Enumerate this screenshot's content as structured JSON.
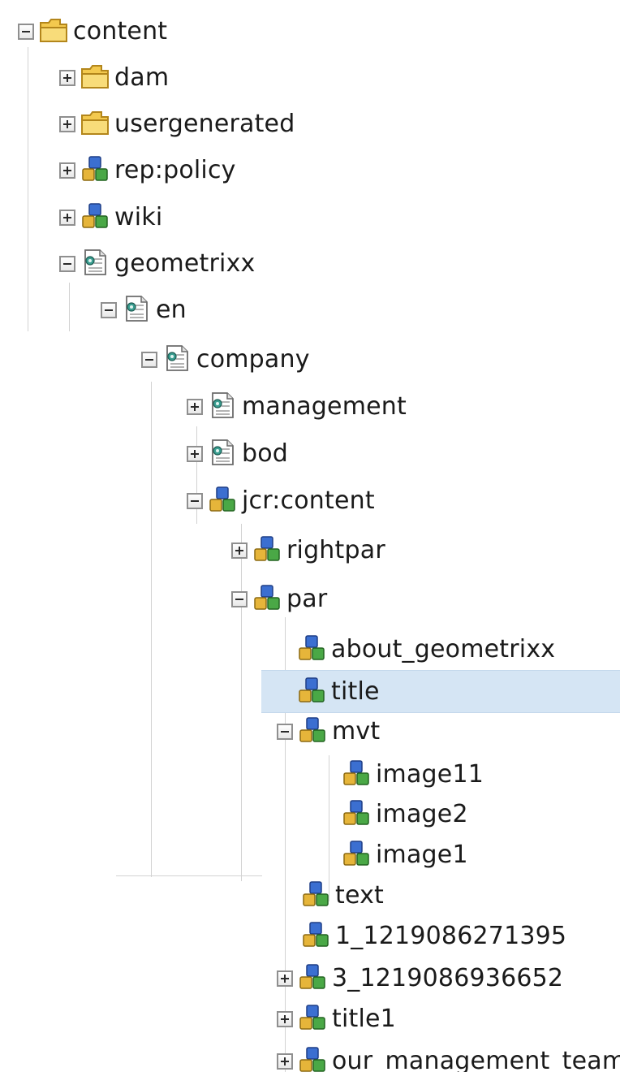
{
  "tree": {
    "nodes": [
      {
        "key": "content",
        "label": "content",
        "icon": "folder-icon",
        "toggle": "minus"
      },
      {
        "key": "dam",
        "label": "dam",
        "icon": "folder-icon",
        "toggle": "plus"
      },
      {
        "key": "usergenerated",
        "label": "usergenerated",
        "icon": "folder-icon",
        "toggle": "plus"
      },
      {
        "key": "rep-policy",
        "label": "rep:policy",
        "icon": "node-cubes-icon",
        "toggle": "plus"
      },
      {
        "key": "wiki",
        "label": "wiki",
        "icon": "node-cubes-icon",
        "toggle": "plus"
      },
      {
        "key": "geometrixx",
        "label": "geometrixx",
        "icon": "page-icon",
        "toggle": "minus"
      },
      {
        "key": "en",
        "label": "en",
        "icon": "page-icon",
        "toggle": "minus"
      },
      {
        "key": "company",
        "label": "company",
        "icon": "page-icon",
        "toggle": "minus"
      },
      {
        "key": "management",
        "label": "management",
        "icon": "page-icon",
        "toggle": "plus"
      },
      {
        "key": "bod",
        "label": "bod",
        "icon": "page-icon",
        "toggle": "plus"
      },
      {
        "key": "jcr-content",
        "label": "jcr:content",
        "icon": "node-cubes-icon",
        "toggle": "minus"
      },
      {
        "key": "rightpar",
        "label": "rightpar",
        "icon": "node-cubes-icon",
        "toggle": "plus"
      },
      {
        "key": "par",
        "label": "par",
        "icon": "node-cubes-icon",
        "toggle": "minus"
      },
      {
        "key": "about-geometrixx",
        "label": "about_geometrixx",
        "icon": "node-cubes-icon",
        "toggle": "none"
      },
      {
        "key": "title",
        "label": "title",
        "icon": "node-cubes-icon",
        "toggle": "none",
        "selected": true
      },
      {
        "key": "mvt",
        "label": "mvt",
        "icon": "node-cubes-icon",
        "toggle": "minus"
      },
      {
        "key": "image11",
        "label": "image11",
        "icon": "node-cubes-icon",
        "toggle": "none"
      },
      {
        "key": "image2",
        "label": "image2",
        "icon": "node-cubes-icon",
        "toggle": "none"
      },
      {
        "key": "image1",
        "label": "image1",
        "icon": "node-cubes-icon",
        "toggle": "none"
      },
      {
        "key": "text",
        "label": "text",
        "icon": "node-cubes-icon",
        "toggle": "none"
      },
      {
        "key": "node-1219086271395",
        "label": "1_1219086271395",
        "icon": "node-cubes-icon",
        "toggle": "none"
      },
      {
        "key": "node-1219086936652",
        "label": "3_1219086936652",
        "icon": "node-cubes-icon",
        "toggle": "plus"
      },
      {
        "key": "title1",
        "label": "title1",
        "icon": "node-cubes-icon",
        "toggle": "plus"
      },
      {
        "key": "our-management-team",
        "label": "our_management_team",
        "icon": "node-cubes-icon",
        "toggle": "plus"
      }
    ]
  },
  "colors": {
    "selection": "#d5e5f4",
    "guide": "#d2d2d2",
    "text": "#1a1a1a"
  }
}
